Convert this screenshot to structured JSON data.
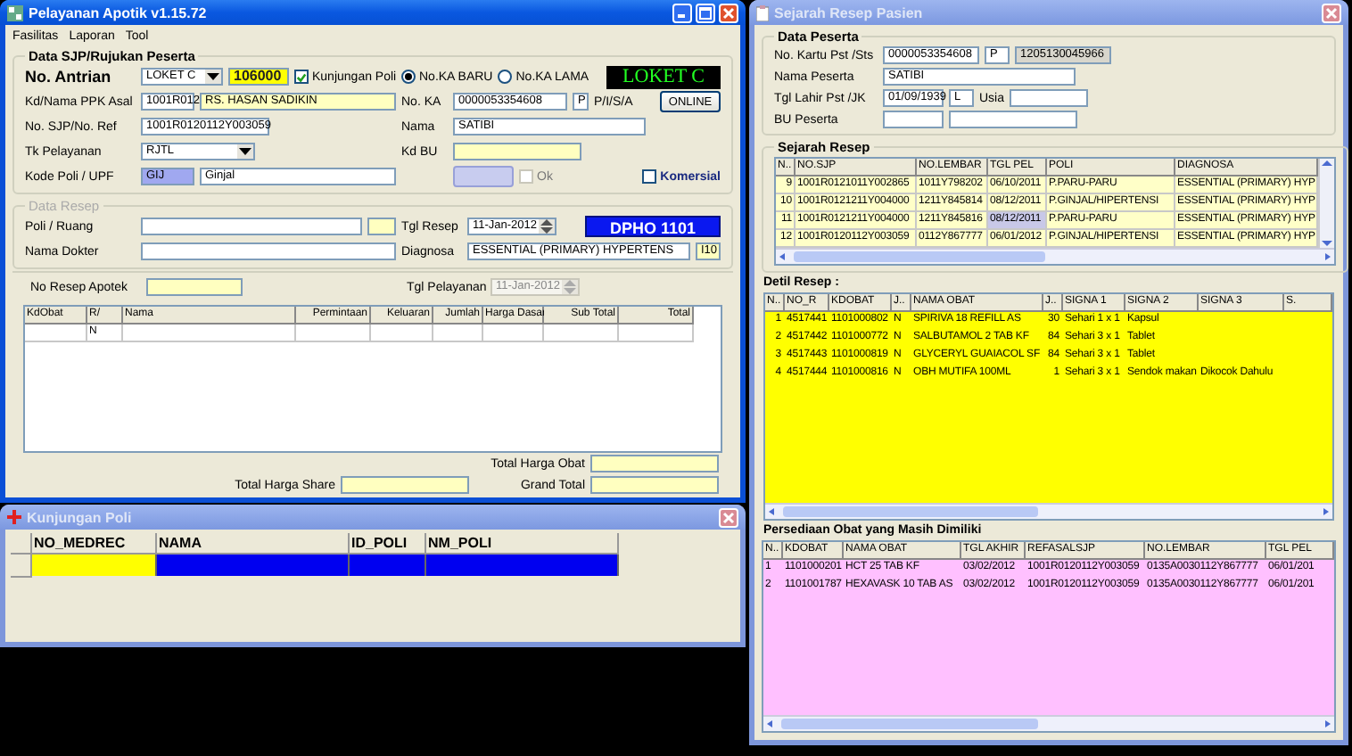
{
  "main_window": {
    "title": "Pelayanan Apotik v1.15.72",
    "menu": [
      "Fasilitas",
      "Laporan",
      "Tool"
    ],
    "sjp_group": {
      "title": "Data SJP/Rujukan Peserta",
      "antrian": {
        "label": "No. Antrian",
        "loket": "LOKET C",
        "number": "106000"
      },
      "kunjungan_poli": {
        "label": "Kunjungan Poli",
        "checked": true
      },
      "radios": [
        {
          "label": "No.KA BARU",
          "selected": true
        },
        {
          "label": "No.KA LAMA",
          "selected": false
        }
      ],
      "loket_display": "LOKET C",
      "ppk": {
        "label": "Kd/Nama PPK Asal",
        "code": "1001R012",
        "name": "RS. HASAN SADIKIN"
      },
      "no_ka": {
        "label": "No. KA",
        "value": "0000053354608",
        "flag": "P",
        "type": "P/I/S/A"
      },
      "online_button": "ONLINE",
      "sjp": {
        "label": "No. SJP/No. Ref",
        "value": "1001R0120112Y003059"
      },
      "nama": {
        "label": "Nama",
        "value": "SATIBI"
      },
      "tk_pelayanan": {
        "label": "Tk Pelayanan",
        "value": "RJTL"
      },
      "kd_bu": {
        "label": "Kd BU"
      },
      "poli": {
        "label": "Kode Poli / UPF",
        "code": "GIJ",
        "name": "Ginjal"
      },
      "ok_check": {
        "label": "Ok",
        "checked": false,
        "disabled": true
      },
      "komersial_check": {
        "label": "Komersial",
        "checked": false
      }
    },
    "resep_group": {
      "title": "Data Resep",
      "poli_ruang": {
        "label": "Poli / Ruang"
      },
      "dokter": {
        "label": "Nama Dokter"
      },
      "tgl_resep": {
        "label": "Tgl Resep",
        "value": "11-Jan-2012"
      },
      "dpho": "DPHO 1101",
      "diagnosa": {
        "label": "Diagnosa",
        "value": "ESSENTIAL (PRIMARY) HYPERTENS",
        "code": "I10"
      }
    },
    "no_resep": {
      "label": "No Resep Apotek"
    },
    "tgl_pelayanan": {
      "label": "Tgl Pelayanan",
      "value": "11-Jan-2012",
      "disabled": true
    },
    "grid": {
      "columns": [
        "KdObat",
        "R/",
        "Nama",
        "Permintaan",
        "Keluaran",
        "Jumlah",
        "Harga Dasar",
        "Sub Total",
        "Total"
      ],
      "rows": [
        {
          "r_flag": "N"
        }
      ]
    },
    "totals": {
      "obat": "Total Harga Obat",
      "share": "Total Harga Share",
      "grand": "Grand Total"
    }
  },
  "poli_window": {
    "title": "Kunjungan Poli",
    "columns": [
      "NO_MEDREC",
      "NAMA",
      "ID_POLI",
      "NM_POLI"
    ],
    "rows": [
      {
        "selected": true
      }
    ]
  },
  "history_window": {
    "title": "Sejarah Resep Pasien",
    "peserta": {
      "title": "Data Peserta",
      "kartu": {
        "label": "No. Kartu Pst /Sts",
        "value": "0000053354608",
        "status": "P",
        "id": "1205130045966"
      },
      "nama": {
        "label": "Nama Peserta",
        "value": "SATIBI"
      },
      "lahir": {
        "label": "Tgl Lahir Pst /JK",
        "value": "01/09/1939",
        "jk": "L",
        "usia_label": "Usia"
      },
      "bu": {
        "label": "BU Peserta"
      }
    },
    "sejarah": {
      "title": "Sejarah Resep",
      "columns": [
        "N..",
        "NO.SJP",
        "NO.LEMBAR",
        "TGL PEL",
        "POLI",
        "DIAGNOSA"
      ],
      "rows": [
        {
          "cells": [
            "9",
            "1001R0121011Y002865",
            "1011Y798202",
            "06/10/2011",
            "P.PARU-PARU",
            "ESSENTIAL (PRIMARY) HYP"
          ],
          "selected": false
        },
        {
          "cells": [
            "10",
            "1001R0121211Y004000",
            "1211Y845814",
            "08/12/2011",
            "P.GINJAL/HIPERTENSI",
            "ESSENTIAL (PRIMARY) HYP"
          ],
          "selected": false
        },
        {
          "cells": [
            "11",
            "1001R0121211Y004000",
            "1211Y845816",
            "08/12/2011",
            "P.PARU-PARU",
            "ESSENTIAL (PRIMARY) HYP"
          ],
          "selected": true
        },
        {
          "cells": [
            "12",
            "1001R0120112Y003059",
            "0112Y867777",
            "06/01/2012",
            "P.GINJAL/HIPERTENSI",
            "ESSENTIAL (PRIMARY) HYP"
          ],
          "selected": false
        }
      ]
    },
    "detil": {
      "title": "Detil Resep :",
      "columns": [
        "N..",
        "NO_R",
        "KDOBAT",
        "J..",
        "NAMA OBAT",
        "J..",
        "SIGNA 1",
        "SIGNA 2",
        "SIGNA 3",
        "S."
      ],
      "rows": [
        [
          "1",
          "4517441",
          "1101000802",
          "N",
          "SPIRIVA 18 REFILL AS",
          "30",
          "Sehari 1 x 1",
          "Kapsul"
        ],
        [
          "2",
          "4517442",
          "1101000772",
          "N",
          "SALBUTAMOL 2 TAB KF",
          "84",
          "Sehari 3 x 1",
          "Tablet"
        ],
        [
          "3",
          "4517443",
          "1101000819",
          "N",
          "GLYCERYL GUAIACOL SF",
          "84",
          "Sehari 3 x 1",
          "Tablet"
        ],
        [
          "4",
          "4517444",
          "1101000816",
          "N",
          "OBH MUTIFA 100ML",
          "1",
          "Sehari 3 x 1",
          "Sendok makan",
          "Dikocok Dahulu"
        ]
      ]
    },
    "persediaan": {
      "title": "Persediaan Obat yang Masih Dimiliki",
      "columns": [
        "N..",
        "KDOBAT",
        "NAMA OBAT",
        "TGL AKHIR",
        "REFASALSJP",
        "NO.LEMBAR",
        "TGL PEL"
      ],
      "rows": [
        [
          "1",
          "1101000201",
          "HCT 25 TAB KF",
          "03/02/2012",
          "1001R0120112Y003059",
          "0135A0030112Y867777",
          "06/01/201"
        ],
        [
          "2",
          "1101001787",
          "HEXAVASK 10 TAB AS",
          "03/02/2012",
          "1001R0120112Y003059",
          "0135A0030112Y867777",
          "06/01/201"
        ]
      ]
    }
  }
}
